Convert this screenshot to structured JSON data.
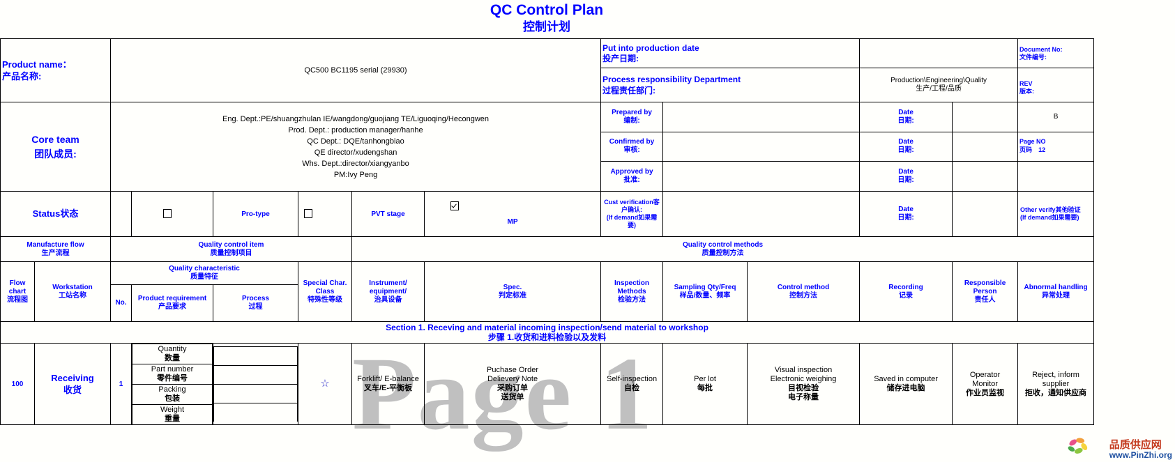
{
  "title": {
    "en": "QC Control Plan",
    "cn": "控制计划"
  },
  "colors": {
    "heading": "#0000ff",
    "text": "#000000",
    "border": "#000000",
    "watermark": "#b6b6b6",
    "brand_cn": "#c43a1e",
    "brand_url": "#1d4fa0"
  },
  "watermark": {
    "page": "Page 1",
    "brand_cn": "品质供应网",
    "brand_url": "www.PinZhi.org"
  },
  "header": {
    "product_name_label_en": "Product name：",
    "product_name_label_cn": "产品名称:",
    "product_name_value": "QC500 BC1195 serial (29930)",
    "put_into_production_en": "Put into production date",
    "put_into_production_cn": "投产日期:",
    "put_into_production_value": "",
    "document_no_en": "Document No:",
    "document_no_cn": "文件编号:",
    "document_no_value": "",
    "process_resp_en": "Process responsibility Department",
    "process_resp_cn": "过程责任部门:",
    "process_resp_value_en": "Production\\Engineering\\Quality",
    "process_resp_value_cn": "生产/工程/品质",
    "rev_en": "REV",
    "rev_cn": "版本:",
    "rev_value": "B",
    "core_team_en": "Core team",
    "core_team_cn": "团队成员:",
    "core_team_lines": [
      "Eng. Dept.:PE/shuangzhulan   IE/wangdong/guojiang     TE/Liguoqing/Hecongwen",
      "Prod. Dept.: production manager/hanhe",
      "QC Dept.: DQE/tanhongbiao",
      "QE director/xudengshan",
      "Whs. Dept.:director/xiangyanbo",
      "PM:Ivy Peng"
    ],
    "signoff": [
      {
        "role_en": "Prepared by",
        "role_cn": "编制:",
        "role_value": "",
        "date_en": "Date",
        "date_cn": "日期:",
        "date_value": ""
      },
      {
        "role_en": "Confirmed by",
        "role_cn": "审核:",
        "role_value": "",
        "date_en": "Date",
        "date_cn": "日期:",
        "date_value": ""
      },
      {
        "role_en": "Approved by",
        "role_cn": "批准:",
        "role_value": "",
        "date_en": "Date",
        "date_cn": "日期:",
        "date_value": ""
      }
    ],
    "page_no_en": "Page NO",
    "page_no_cn": "页码",
    "page_no_value": "12"
  },
  "status": {
    "label": "Status状态",
    "options": [
      {
        "label": "Pro-type",
        "checked": false
      },
      {
        "label": "PVT stage",
        "checked": false
      },
      {
        "label": "MP",
        "checked": true
      }
    ],
    "cust_verification_en": "Cust verification客户确认:",
    "cust_verification_note": "(If demand如果需要)",
    "cust_verification_value": "",
    "date_en": "Date",
    "date_cn": "日期:",
    "date_value": "",
    "other_verify_en": "Other verify其他验证",
    "other_verify_note": "(If demand如果需要)"
  },
  "group_headers": {
    "manufacture_flow_en": "Manufacture flow",
    "manufacture_flow_cn": "生产流程",
    "quality_control_item_en": "Quality control item",
    "quality_control_item_cn": "质量控制项目",
    "quality_control_methods_en": "Quality control methods",
    "quality_control_methods_cn": "质量控制方法",
    "quality_characteristic_en": "Quality characteristic",
    "quality_characteristic_cn": "质量特征"
  },
  "columns": [
    {
      "en": "Flow chart",
      "cn": "流程图"
    },
    {
      "en": "Workstation",
      "cn": "工站名称"
    },
    {
      "en": "No.",
      "cn": ""
    },
    {
      "en": "Product requirement",
      "cn": "产品要求"
    },
    {
      "en": "Process",
      "cn": "过程"
    },
    {
      "en": "Special Char. Class",
      "cn": "特殊性等级"
    },
    {
      "en": "Instrument/ equipment/",
      "cn": "治具设备"
    },
    {
      "en": "Spec.",
      "cn": "判定标准"
    },
    {
      "en": "Inspection Methods",
      "cn": "检验方法"
    },
    {
      "en": "Sampling Qty/Freq",
      "cn": "样品/数量、频率"
    },
    {
      "en": "Control method",
      "cn": "控制方法"
    },
    {
      "en": "Recording",
      "cn": "记录"
    },
    {
      "en": "Responsible Person",
      "cn": "责任人"
    },
    {
      "en": "Abnormal handling",
      "cn": "异常处理"
    }
  ],
  "section": {
    "title_en": "Section 1.  Receving and material incoming inspection/send material to workshop",
    "title_cn": "步骤  1.收货和进料检验以及发料"
  },
  "rows": [
    {
      "flow_chart": "100",
      "workstation_en": "Receiving",
      "workstation_cn": "收货",
      "no": "1",
      "product_requirements": [
        {
          "en": "Quantity",
          "cn": "数量"
        },
        {
          "en": "Part number",
          "cn": "零件编号"
        },
        {
          "en": "Packing",
          "cn": "包装"
        },
        {
          "en": "Weight",
          "cn": "重量"
        }
      ],
      "process": [
        "",
        "",
        "",
        ""
      ],
      "special_char_class": "☆",
      "instrument_en": "Forklift/ E-balance",
      "instrument_cn": "叉车/E-平衡板",
      "spec_en": "Puchase Order\nDelievery Note",
      "spec_cn": "采购订单\n送货单",
      "inspection_en": "Self-inspection",
      "inspection_cn": "自检",
      "sampling_en": "Per lot",
      "sampling_cn": "每批",
      "control_en": "Visual inspection\nElectronic weighing",
      "control_cn": "目视检验\n电子称量",
      "recording_en": "Saved in computer",
      "recording_cn": "储存进电脑",
      "responsible_en": "Operator\nMonitor",
      "responsible_cn": "作业员监视",
      "abnormal_en": "Reject, inform supplier",
      "abnormal_cn": "拒收，通知供应商"
    }
  ]
}
